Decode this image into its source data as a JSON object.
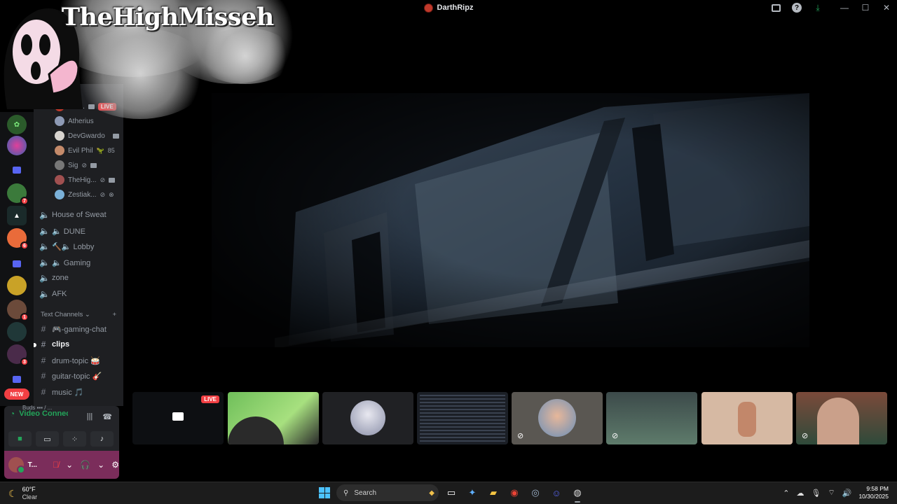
{
  "window": {
    "title": "DarthRipz"
  },
  "overlay": {
    "brand": "TheHighMisseh"
  },
  "channels": {
    "members": [
      {
        "name": "Dar...",
        "live_label": "LIVE"
      },
      {
        "name": "Atherius"
      },
      {
        "name": "DevGwardo"
      },
      {
        "name": "Evil Phil",
        "extra": "85"
      },
      {
        "name": "Sig"
      },
      {
        "name": "TheHig..."
      },
      {
        "name": "Zestiak..."
      }
    ],
    "voice": [
      {
        "label": "House of Sweat"
      },
      {
        "label": "🔈 DUNE"
      },
      {
        "label": "🔨🔈 Lobby"
      },
      {
        "label": "🔈 Gaming"
      },
      {
        "label": "zone"
      },
      {
        "label": "AFK"
      }
    ],
    "text_category": "Text Channels",
    "text": [
      {
        "label": "🎮-gaming-chat"
      },
      {
        "label": "clips"
      },
      {
        "label": "drum-topic 🥁"
      },
      {
        "label": "guitar-topic 🎸"
      },
      {
        "label": "music 🎵"
      }
    ]
  },
  "rail": {
    "badges": [
      "7",
      "6",
      "1",
      "3"
    ],
    "new_label": "NEW"
  },
  "voice_panel": {
    "title": "Video Connected",
    "subtitle": "Buds ▪▪▪ / ..."
  },
  "user": {
    "name": "T..."
  },
  "strip": {
    "live_label": "LIVE"
  },
  "taskbar": {
    "temp": "60°F",
    "condition": "Clear",
    "search_placeholder": "Search",
    "time": "9:58 PM",
    "date": "10/30/2025"
  }
}
